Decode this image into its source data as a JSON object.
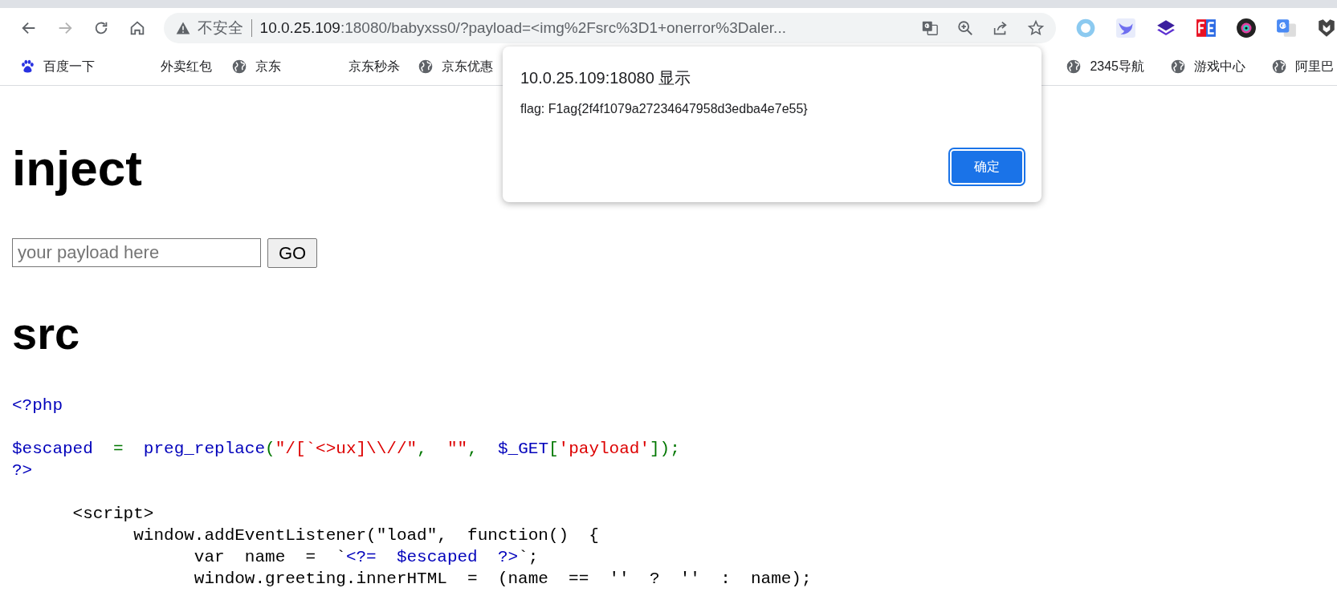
{
  "toolbar": {
    "forward_disabled": true,
    "security_label": "不安全",
    "url_host": "10.0.25.109",
    "url_rest": ":18080/babyxss0/?payload=<img%2Fsrc%3D1+onerror%3Daler..."
  },
  "bookmarks_left": [
    {
      "label": "百度一下",
      "kind": "paw"
    },
    {
      "label": "外卖红包",
      "kind": "blank"
    },
    {
      "label": "京东",
      "kind": "globe"
    },
    {
      "label": "京东秒杀",
      "kind": "blank"
    },
    {
      "label": "京东优惠",
      "kind": "globe"
    }
  ],
  "bookmarks_right": [
    {
      "label": "2345导航",
      "kind": "globe"
    },
    {
      "label": "游戏中心",
      "kind": "globe"
    },
    {
      "label": "阿里巴",
      "kind": "globe"
    }
  ],
  "page": {
    "heading": "inject",
    "input_placeholder": "your payload here",
    "button": "GO",
    "source_heading": "src"
  },
  "code_lines": [
    {
      "blank_before": false,
      "tokens": [
        {
          "kind": "php",
          "text": "<?php"
        }
      ]
    },
    {
      "blank_before": true,
      "tokens": [
        {
          "kind": "php",
          "text": "$escaped"
        },
        {
          "kind": "op",
          "text": "  =  "
        },
        {
          "kind": "php",
          "text": "preg_replace"
        },
        {
          "kind": "op",
          "text": "("
        },
        {
          "kind": "str",
          "text": "\"/[`<>ux]\\\\//\""
        },
        {
          "kind": "op",
          "text": ",  "
        },
        {
          "kind": "str",
          "text": "\"\""
        },
        {
          "kind": "op",
          "text": ",  "
        },
        {
          "kind": "php",
          "text": "$_GET"
        },
        {
          "kind": "op",
          "text": "["
        },
        {
          "kind": "str",
          "text": "'payload'"
        },
        {
          "kind": "op",
          "text": "]);"
        }
      ]
    },
    {
      "blank_before": false,
      "tokens": [
        {
          "kind": "php",
          "text": "?>"
        }
      ]
    },
    {
      "blank_before": true,
      "tokens": [
        {
          "kind": "html",
          "text": "      <script>"
        }
      ]
    },
    {
      "blank_before": false,
      "tokens": [
        {
          "kind": "html",
          "text": "            window.addEventListener(\"load\",  function()  {"
        }
      ]
    },
    {
      "blank_before": false,
      "tokens": [
        {
          "kind": "html",
          "text": "                  var  name  =  `"
        },
        {
          "kind": "php",
          "text": "<?=  $escaped  ?>"
        },
        {
          "kind": "html",
          "text": "`;"
        }
      ]
    },
    {
      "blank_before": false,
      "tokens": [
        {
          "kind": "html",
          "text": "                  window.greeting.innerHTML  =  (name  ==  ''  ?  ''  :  name);"
        }
      ]
    }
  ],
  "dialog": {
    "title": "10.0.25.109:18080 显示",
    "message": "flag: F1ag{2f4f1079a27234647958d3edba4e7e55}",
    "button": "确定"
  }
}
